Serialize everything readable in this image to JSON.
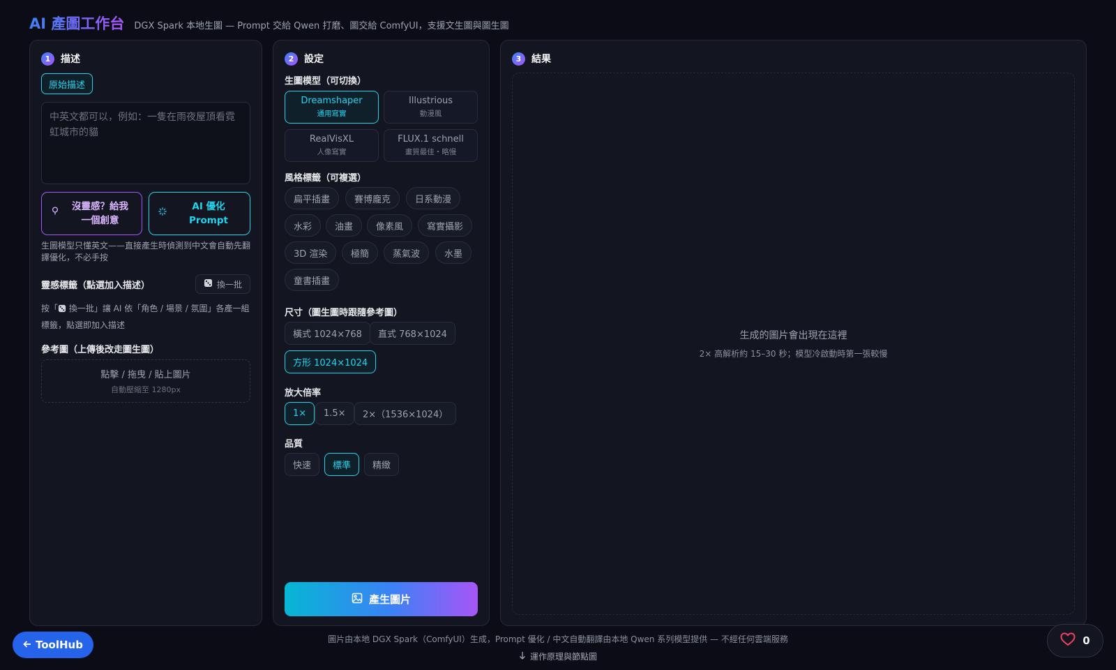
{
  "header": {
    "title": "AI 產圖工作台",
    "subtitle": "DGX Spark 本地生圖 — Prompt 交給 Qwen 打磨、圖交給 ComfyUI，支援文生圖與圖生圖"
  },
  "panel_desc": {
    "step": "1",
    "title": "描述",
    "tab": "原始描述",
    "textarea_placeholder": "中英文都可以，例如：一隻在雨夜屋頂看霓虹城市的貓",
    "btn_idea_icon": "lightbulb-icon",
    "btn_idea_label": "沒靈感？給我一個創意",
    "btn_optimize_icon": "spinner-icon",
    "btn_optimize_label": "AI 優化 Prompt",
    "hint": "生圖模型只懂英文——直接產生時偵測到中文會自動先翻譯優化，不必手按",
    "inspiration_label": "靈感標籤（點選加入描述）",
    "shuffle_icon": "dice-icon",
    "shuffle_label": "換一批",
    "inspiration_hint_pre": "按「",
    "inspiration_hint_post": " 換一批」讓 AI 依「角色 / 場景 / 氛圍」各產一組標籤，點選即加入描述",
    "reference_label": "參考圖（上傳後改走圖生圖）",
    "dropzone_main": "點擊 / 拖曳 / 貼上圖片",
    "dropzone_sub": "自動壓縮至 1280px"
  },
  "panel_settings": {
    "step": "2",
    "title": "設定",
    "model_label": "生圖模型（可切換）",
    "models": [
      {
        "name": "Dreamshaper",
        "sub": "通用寫實",
        "active": true
      },
      {
        "name": "Illustrious",
        "sub": "動漫風",
        "active": false
      },
      {
        "name": "RealVisXL",
        "sub": "人像寫實",
        "active": false
      },
      {
        "name": "FLUX.1 schnell",
        "sub": "畫質最佳・略慢",
        "active": false
      }
    ],
    "style_label": "風格標籤（可複選）",
    "styles": [
      "扁平插畫",
      "賽博龐克",
      "日系動漫",
      "水彩",
      "油畫",
      "像素風",
      "寫實攝影",
      "3D 渲染",
      "極簡",
      "蒸氣波",
      "水墨",
      "童書插畫"
    ],
    "size_label": "尺寸（圖生圖時跟隨參考圖）",
    "sizes": [
      "橫式 1024×768",
      "直式 768×1024",
      "方形 1024×1024"
    ],
    "size_selected": "方形 1024×1024",
    "upscale_label": "放大倍率",
    "upscales": [
      "1×",
      "1.5×",
      "2×（1536×1024）"
    ],
    "upscale_selected": "1×",
    "quality_label": "品質",
    "qualities": [
      "快速",
      "標準",
      "精緻"
    ],
    "quality_selected": "標準",
    "generate_icon": "image-icon",
    "generate_label": "產生圖片"
  },
  "panel_result": {
    "step": "3",
    "title": "結果",
    "placeholder_main": "生成的圖片會出現在這裡",
    "placeholder_sub": "2× 高解析約 15–30 秒；模型冷啟動時第一張較慢"
  },
  "footer": {
    "text": "圖片由本地 DGX Spark（ComfyUI）生成，Prompt 優化 / 中文自動翻譯由本地 Qwen 系列模型提供 — 不經任何雲端服務",
    "link_icon": "arrow-down-icon",
    "link": "運作原理與節點圖",
    "toolhub_icon": "arrow-left-icon",
    "toolhub_label": "ToolHub",
    "like_icon": "heart-icon",
    "like_count": "0"
  }
}
